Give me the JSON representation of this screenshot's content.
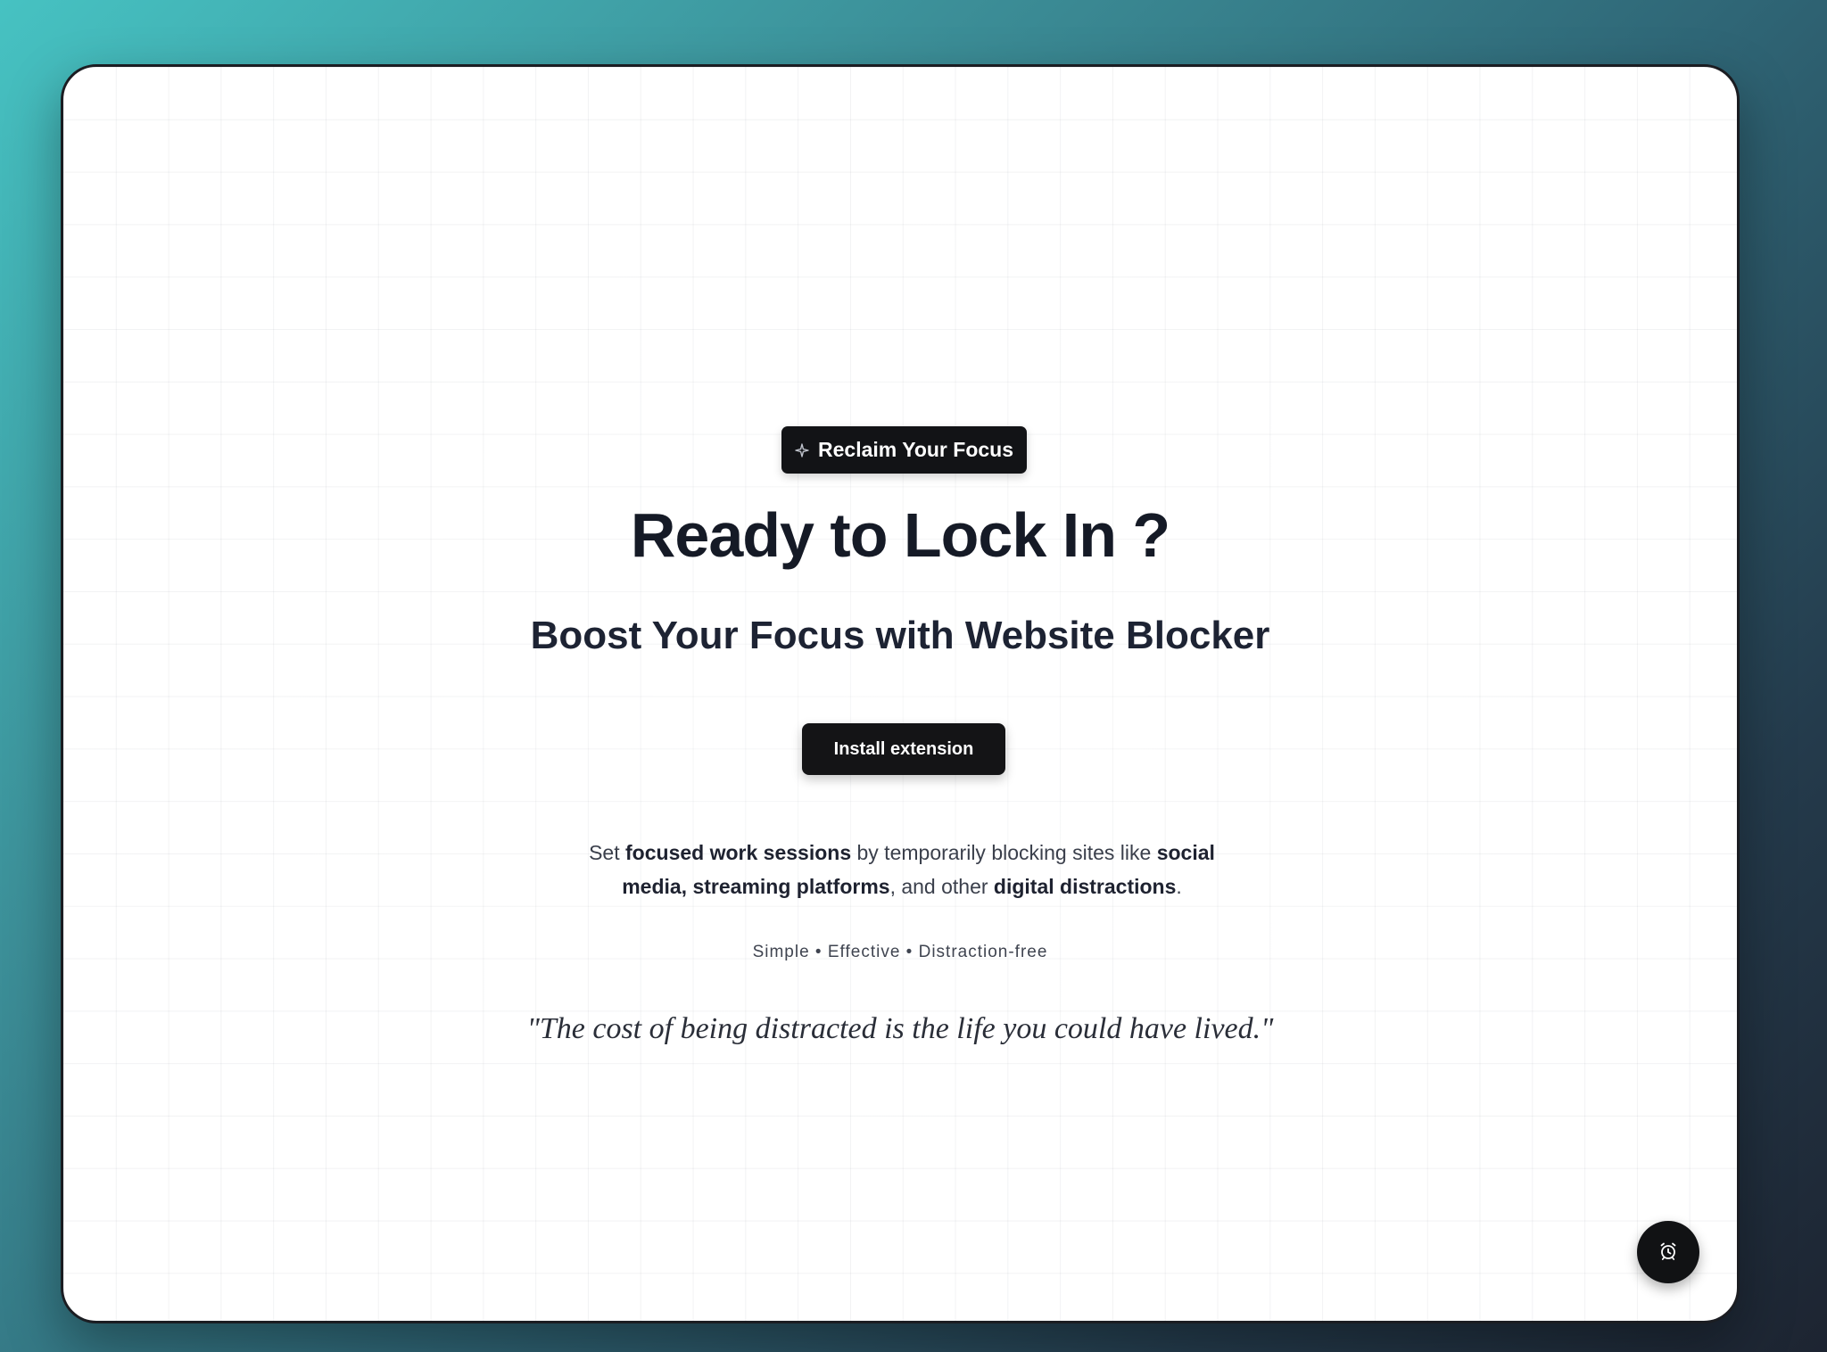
{
  "badge": {
    "label": "Reclaim Your Focus",
    "icon": "sparkle-icon"
  },
  "hero": {
    "title": "Ready to Lock In ?",
    "subtitle": "Boost Your Focus with Website Blocker"
  },
  "cta": {
    "install_label": "Install extension"
  },
  "description": {
    "parts": [
      "Set ",
      "focused work sessions",
      " by temporarily blocking sites like ",
      "social media, streaming platforms",
      ", and other ",
      "digital distractions",
      "."
    ]
  },
  "tagline": "Simple • Effective • Distraction-free",
  "quote": "\"The cost of being distracted is the life you could have lived.\"",
  "fab": {
    "icon": "alarm-clock-icon"
  },
  "colors": {
    "accent": "#121316",
    "text_primary": "#151a26",
    "text_secondary": "#3a3f4b",
    "background_gradient_start": "#46c2c2",
    "background_gradient_end": "#1d2431"
  }
}
